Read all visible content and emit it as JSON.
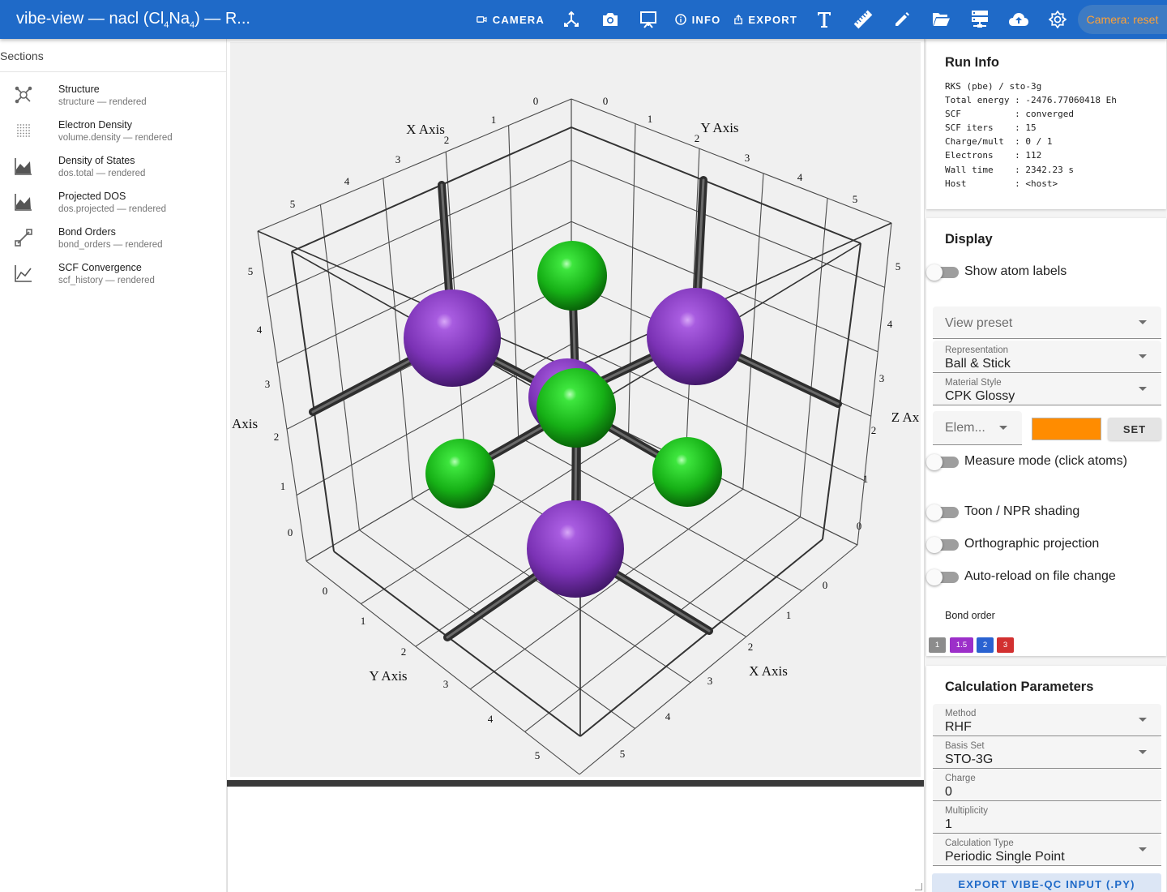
{
  "header": {
    "title_prefix": "vibe-view — nacl (Cl",
    "sub1": "4",
    "title_mid": "Na",
    "sub2": "4",
    "title_suffix": ") — R...",
    "camera_label": "CAMERA",
    "info_label": "INFO",
    "export_label": "EXPORT",
    "camera_reset": "Camera: reset"
  },
  "sections": {
    "heading": "Sections",
    "items": [
      {
        "title": "Structure",
        "subtitle": "structure — rendered",
        "icon": "molecule-icon"
      },
      {
        "title": "Electron Density",
        "subtitle": "volume.density — rendered",
        "icon": "dot-grid-icon"
      },
      {
        "title": "Density of States",
        "subtitle": "dos.total — rendered",
        "icon": "area-chart-icon"
      },
      {
        "title": "Projected DOS",
        "subtitle": "dos.projected — rendered",
        "icon": "area-chart-icon"
      },
      {
        "title": "Bond Orders",
        "subtitle": "bond_orders — rendered",
        "icon": "bond-icon"
      },
      {
        "title": "SCF Convergence",
        "subtitle": "scf_history — rendered",
        "icon": "line-chart-icon"
      }
    ]
  },
  "viewer": {
    "axis_titles": {
      "x_back": "X Axis",
      "y_back": "Y Axis",
      "z_left": "Axis",
      "z_right": "Z Ax",
      "y_front": "Y Axis",
      "x_front": "X Axis"
    },
    "tick_values": [
      "0",
      "1",
      "2",
      "3",
      "4",
      "5"
    ],
    "atom_colors": {
      "Na": "#8a3fc4",
      "Cl": "#1ecb1e"
    }
  },
  "run_info": {
    "title": "Run Info",
    "lines": [
      "RKS (pbe) / sto-3g",
      "Total energy : -2476.77060418 Eh",
      "SCF          : converged",
      "SCF iters    : 15",
      "Charge/mult  : 0 / 1",
      "Electrons    : 112",
      "Wall time    : 2342.23 s",
      "Host         : <host>"
    ]
  },
  "display": {
    "title": "Display",
    "show_atom_labels": "Show atom labels",
    "view_preset_placeholder": "View preset",
    "representation_label": "Representation",
    "representation_value": "Ball & Stick",
    "material_label": "Material Style",
    "material_value": "CPK Glossy",
    "element_placeholder": "Elem...",
    "element_color": "#ff8c00",
    "set_label": "SET",
    "measure_mode": "Measure mode (click atoms)",
    "toon_shading": "Toon / NPR shading",
    "orthographic": "Orthographic projection",
    "auto_reload": "Auto-reload on file change",
    "bond_order_label": "Bond order",
    "bond_orders": [
      {
        "label": "1",
        "color": "#8c8c8c"
      },
      {
        "label": "1.5",
        "color": "#9c2fc9"
      },
      {
        "label": "2",
        "color": "#2a62d1"
      },
      {
        "label": "3",
        "color": "#d23030"
      }
    ]
  },
  "calc": {
    "title": "Calculation Parameters",
    "method_label": "Method",
    "method_value": "RHF",
    "basis_label": "Basis Set",
    "basis_value": "STO-3G",
    "charge_label": "Charge",
    "charge_value": "0",
    "multiplicity_label": "Multiplicity",
    "multiplicity_value": "1",
    "calc_type_label": "Calculation Type",
    "calc_type_value": "Periodic Single Point",
    "export_label": "EXPORT VIBE-QC INPUT (.PY)"
  }
}
